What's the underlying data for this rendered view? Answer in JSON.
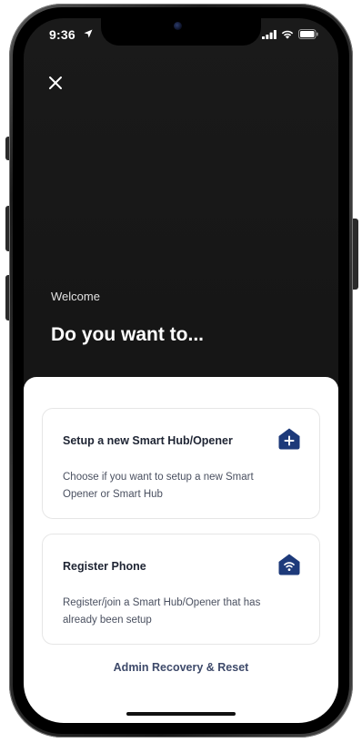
{
  "status_bar": {
    "time": "9:36",
    "location_icon": "location-arrow-icon",
    "signal_icon": "cellular-signal-icon",
    "wifi_icon": "wifi-icon",
    "battery_icon": "battery-icon"
  },
  "header": {
    "close_icon": "close-icon",
    "welcome": "Welcome",
    "headline": "Do you want to..."
  },
  "options": [
    {
      "title": "Setup a new Smart Hub/Opener",
      "description": "Choose if you want to setup a new Smart Opener or Smart Hub",
      "icon": "home-plus-icon"
    },
    {
      "title": "Register Phone",
      "description": "Register/join a Smart Hub/Opener that has already been setup",
      "icon": "home-wifi-icon"
    }
  ],
  "footer": {
    "admin_link": "Admin Recovery & Reset"
  },
  "colors": {
    "accent": "#1d3a7a",
    "screen_dark": "#161616",
    "sheet": "#ffffff",
    "link": "#3e4a6a"
  }
}
